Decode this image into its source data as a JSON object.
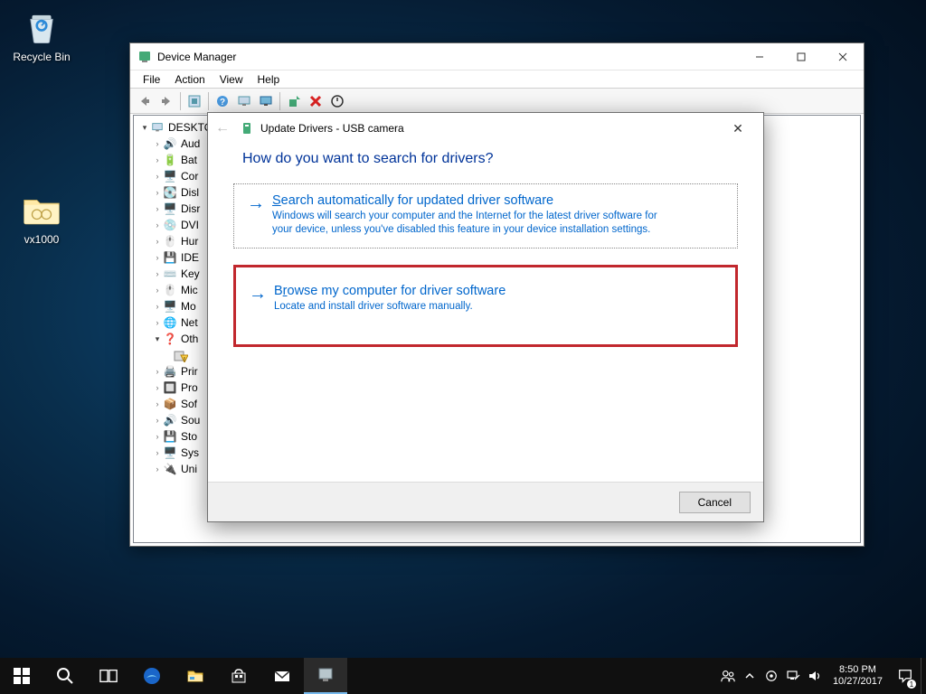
{
  "desktop": {
    "recycle_bin": "Recycle Bin",
    "folder": "vx1000"
  },
  "device_manager": {
    "title": "Device Manager",
    "menu": {
      "file": "File",
      "action": "Action",
      "view": "View",
      "help": "Help"
    },
    "root": "DESKTO",
    "nodes": [
      "Aud",
      "Bat",
      "Cor",
      "Disl",
      "Disr",
      "DVI",
      "Hur",
      "IDE",
      "Key",
      "Mic",
      "Mo",
      "Net",
      "Oth"
    ],
    "nodes2": [
      "Prir",
      "Pro",
      "Sof",
      "Sou",
      "Sto",
      "Sys",
      "Uni"
    ]
  },
  "update_drivers": {
    "title": "Update Drivers - USB camera",
    "heading": "How do you want to search for drivers?",
    "opt1": {
      "prefix": "S",
      "rest": "earch automatically for updated driver software",
      "desc": "Windows will search your computer and the Internet for the latest driver software for your device, unless you've disabled this feature in your device installation settings."
    },
    "opt2": {
      "prefix": "B",
      "mid": "r",
      "rest": "owse my computer for driver software",
      "desc": "Locate and install driver software manually."
    },
    "cancel": "Cancel"
  },
  "taskbar": {
    "time": "8:50 PM",
    "date": "10/27/2017",
    "notif_count": "1"
  }
}
